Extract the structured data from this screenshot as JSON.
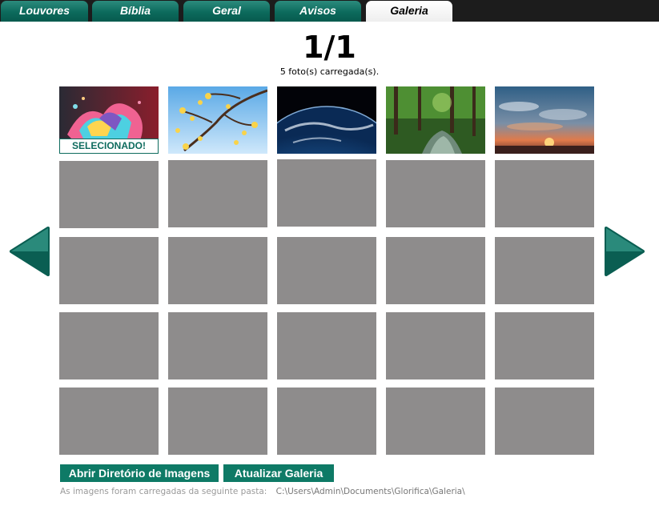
{
  "tabs": [
    {
      "label": "Louvores",
      "active": false
    },
    {
      "label": "Bíblia",
      "active": false
    },
    {
      "label": "Geral",
      "active": false
    },
    {
      "label": "Avisos",
      "active": false
    },
    {
      "label": "Galeria",
      "active": true
    }
  ],
  "gallery": {
    "page_counter": "1/1",
    "photo_count_text": "5 foto(s) carregada(s).",
    "selected_label": "SELECIONADO!",
    "selected_index": 0,
    "loaded_photos": 5,
    "grid_rows": 5,
    "grid_columns": 5
  },
  "photos": [
    {
      "subject": "color-splash"
    },
    {
      "subject": "flowering-branch"
    },
    {
      "subject": "earth-from-space"
    },
    {
      "subject": "forest-stream"
    },
    {
      "subject": "sunset-sky"
    }
  ],
  "actions": {
    "open_dir": "Abrir Diretório de Imagens",
    "refresh": "Atualizar Galeria"
  },
  "footer": {
    "text": "As imagens foram carregadas da seguinte pasta:",
    "path": "C:\\Users\\Admin\\Documents\\Glorifica\\Galeria\\"
  },
  "colors": {
    "accent": "#0e7a66",
    "placeholder": "#8e8c8c",
    "tabbar": "#1c1c1c"
  },
  "icons": {
    "prev": "arrow-left-icon",
    "next": "arrow-right-icon"
  }
}
